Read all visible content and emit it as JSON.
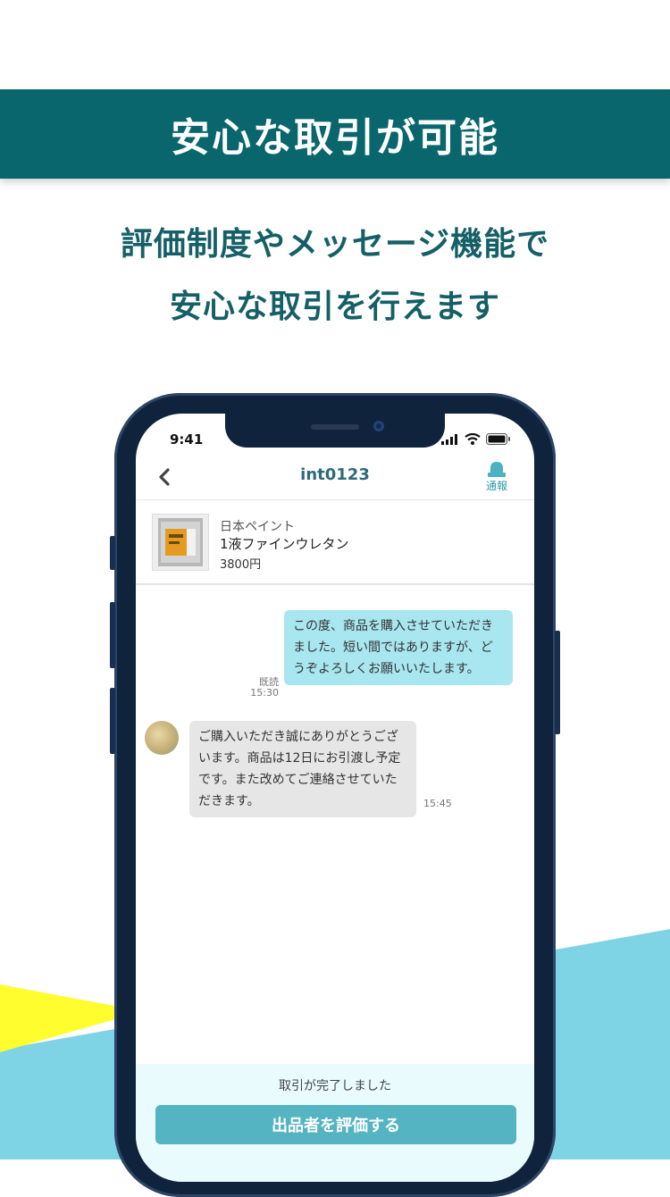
{
  "header": {
    "title": "安心な取引が可能"
  },
  "subtitle": {
    "line1": "評価制度やメッセージ機能で",
    "line2": "安心な取引を行えます"
  },
  "colors": {
    "banner": "#0a666d",
    "accent_text": "#155f66",
    "yellow_shape": "#fffd2e",
    "cyan_shape": "#7ed3e4"
  },
  "phone": {
    "status_time": "9:41",
    "status_icons": [
      "signal-icon",
      "wifi-icon",
      "battery-icon"
    ],
    "nav": {
      "back_icon": "chevron-left-icon",
      "title": "int0123",
      "report_icon": "alert-siren-icon",
      "report_label": "通報"
    },
    "product": {
      "brand": "日本ペイント",
      "name": "1液ファインウレタン",
      "price": "3800円"
    },
    "messages": [
      {
        "direction": "outgoing",
        "text": "この度、商品を購入させていただきました。短い間ではありますが、どうぞよろしくお願いいたします。",
        "read_label": "既読",
        "time": "15:30"
      },
      {
        "direction": "incoming",
        "text": "ご購入いただき誠にありがとうございます。商品は12日にお引渡し予定です。また改めてご連絡させていただきます。",
        "time": "15:45"
      }
    ],
    "footer": {
      "status_text": "取引が完了しました",
      "button_label": "出品者を評価する"
    }
  }
}
